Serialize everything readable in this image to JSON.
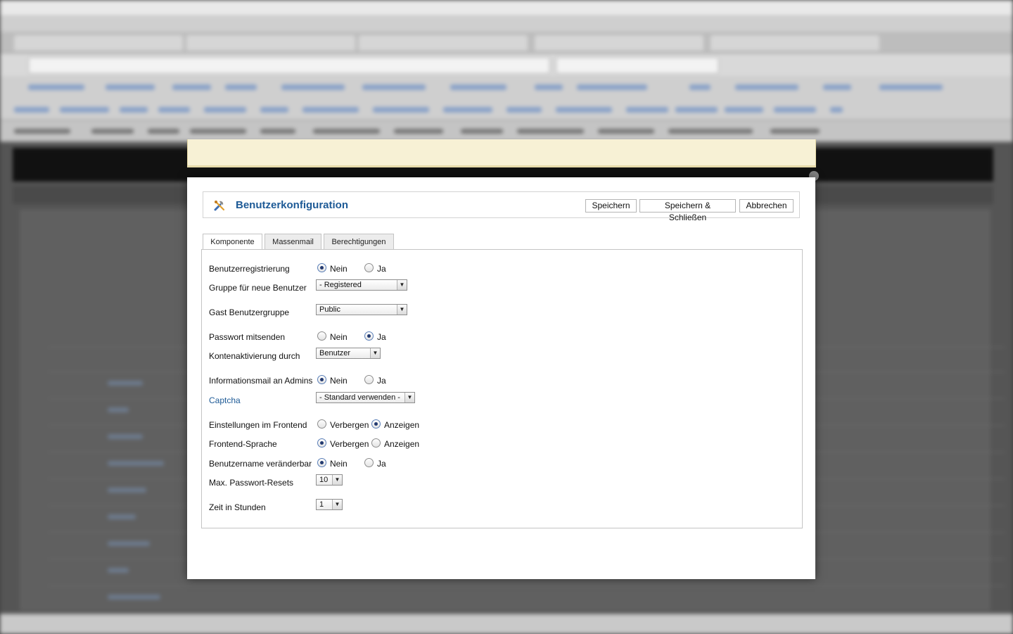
{
  "dialog": {
    "title": "Benutzerkonfiguration",
    "buttons": {
      "save": "Speichern",
      "save_close": "Speichern & Schließen",
      "cancel": "Abbrechen"
    },
    "tabs": [
      {
        "label": "Komponente",
        "active": true
      },
      {
        "label": "Massenmail",
        "active": false
      },
      {
        "label": "Berechtigungen",
        "active": false
      }
    ],
    "radio_labels": {
      "nein": "Nein",
      "ja": "Ja",
      "verbergen": "Verbergen",
      "anzeigen": "Anzeigen"
    },
    "fields": {
      "registrierung": {
        "label": "Benutzerregistrierung",
        "value": "Nein"
      },
      "gruppe_neu": {
        "label": "Gruppe für neue Benutzer",
        "value": "- Registered"
      },
      "gast_gruppe": {
        "label": "Gast Benutzergruppe",
        "value": "Public"
      },
      "passwort_mitsenden": {
        "label": "Passwort mitsenden",
        "value": "Ja"
      },
      "kontenaktivierung": {
        "label": "Kontenaktivierung durch",
        "value": "Benutzer"
      },
      "infomail_admins": {
        "label": "Informationsmail an Admins",
        "value": "Nein"
      },
      "captcha": {
        "label": "Captcha",
        "value": "- Standard verwenden -"
      },
      "einstellungen_frontend": {
        "label": "Einstellungen im Frontend",
        "value": "Anzeigen"
      },
      "frontend_sprache": {
        "label": "Frontend-Sprache",
        "value": "Verbergen"
      },
      "benutzername_aenderbar": {
        "label": "Benutzername veränderbar",
        "value": "Nein"
      },
      "max_resets": {
        "label": "Max. Passwort-Resets",
        "value": "10"
      },
      "zeit_stunden": {
        "label": "Zeit in Stunden",
        "value": "1"
      }
    }
  },
  "colors": {
    "title_blue": "#1d5a96",
    "notice_bg": "#f7f1d5",
    "overlay": "#3f3f3f"
  }
}
